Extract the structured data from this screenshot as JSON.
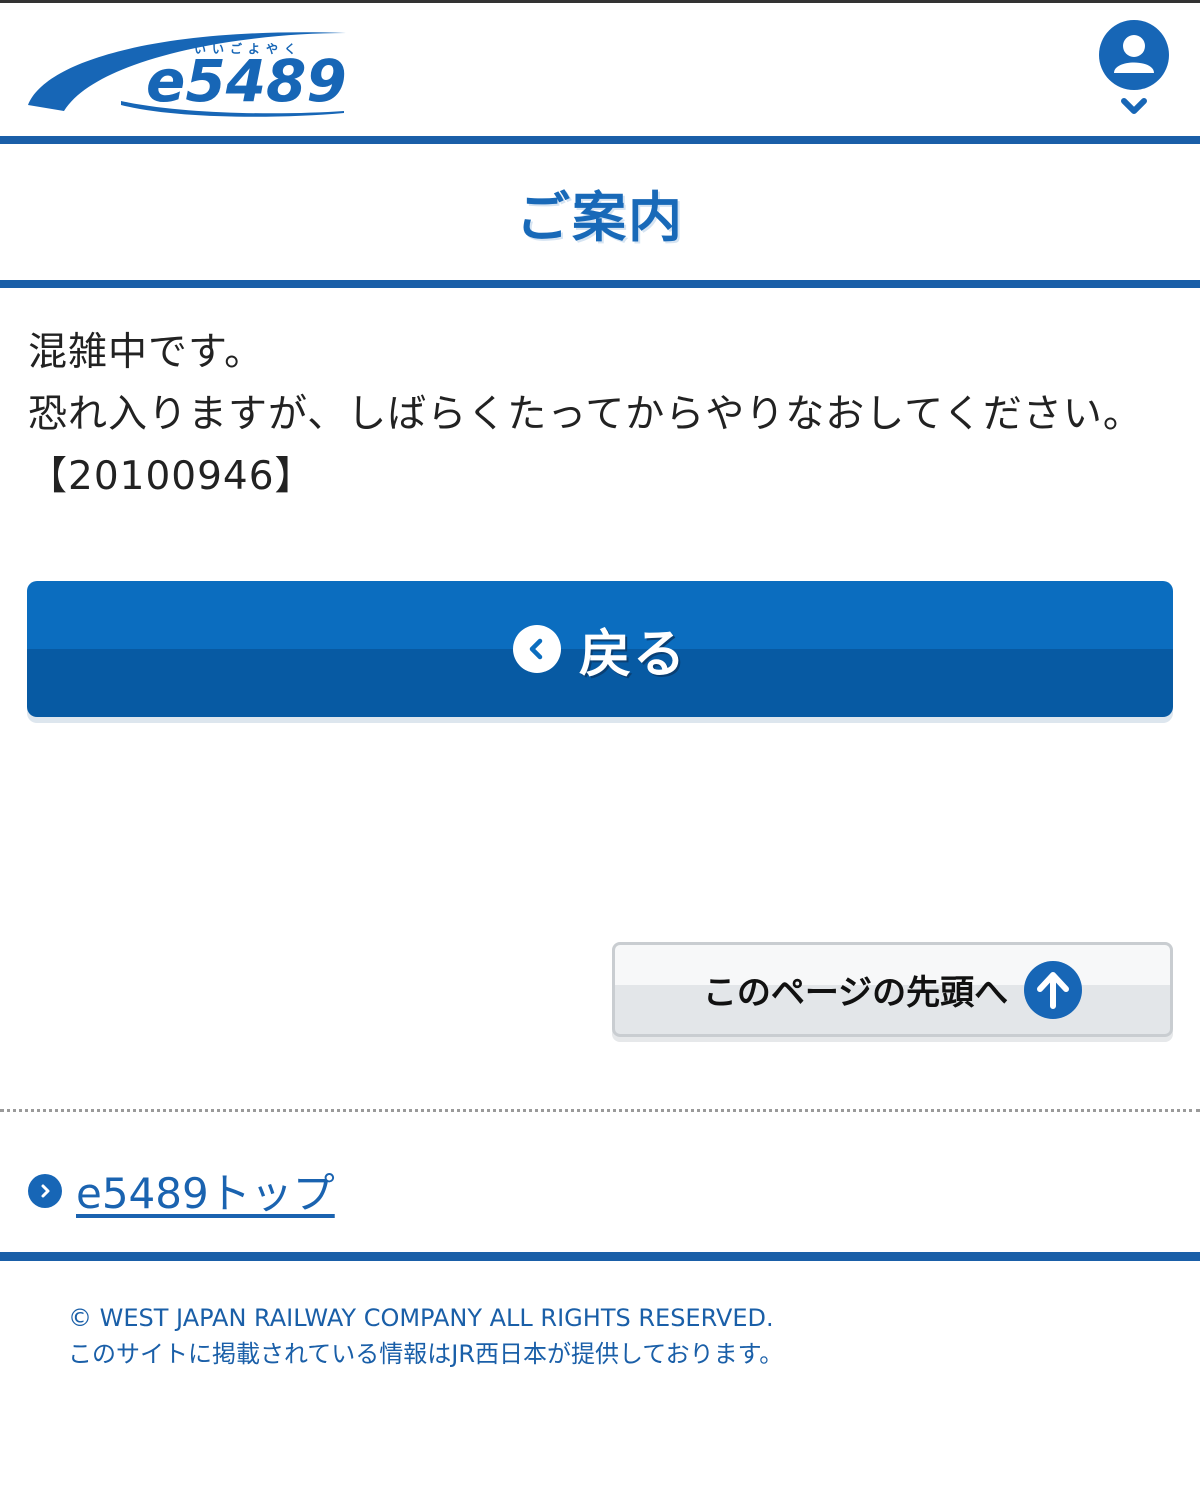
{
  "header": {
    "logo_text": "e5489",
    "logo_ruby": "いいごよやく",
    "icons": {
      "user": "user-icon",
      "chevron": "chevron-down-icon"
    }
  },
  "page": {
    "title": "ご案内",
    "message_lines": [
      "混雑中です。",
      "恐れ入りますが、しばらくたってからやりなおしてください。【20100946】"
    ]
  },
  "buttons": {
    "back_label": "戻る",
    "back_icon": "chevron-left-circle-icon",
    "pagetop_label": "このページの先頭へ",
    "pagetop_icon": "arrow-up-circle-icon"
  },
  "links": {
    "top_label": "e5489トップ",
    "top_icon": "chevron-right-circle-icon"
  },
  "footer": {
    "copyright": "© WEST JAPAN RAILWAY COMPANY ALL RIGHTS RESERVED.",
    "note": "このサイトに掲載されている情報はJR西日本が提供しております。"
  },
  "colors": {
    "brand_blue": "#1a5fa8",
    "button_blue": "#0b6dbf",
    "title_blue": "#1869b8"
  }
}
